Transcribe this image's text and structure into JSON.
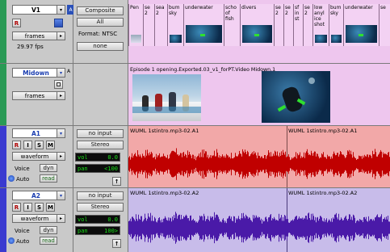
{
  "tracks": {
    "v1": {
      "name": "V1",
      "rec_btn": "R",
      "view": "frames",
      "fps": "29.97 fps",
      "composite": "Composite",
      "all": "All",
      "format": "Format: NTSC",
      "none": "none",
      "clip_labels": [
        "Pen",
        "se 2",
        "sea 2",
        "bum sky",
        "underwater",
        "scho of fish",
        "divers",
        "se 2",
        "se 2",
        "sf in st",
        "se 2",
        "low anyl ice shot",
        "bum sky",
        "underwater",
        "se"
      ]
    },
    "midown": {
      "name": "Midown",
      "view": "frames",
      "clip_title": "Episode 1 opening.Exported.03_v1_forPT.Video Midown.1"
    },
    "a1": {
      "name": "A1",
      "buttons": [
        "R",
        "I",
        "S",
        "M"
      ],
      "view": "waveform",
      "voice_label": "Voice",
      "voice_value": "dyn",
      "auto_label": "Auto",
      "auto_value": "read",
      "input": "no input",
      "output": "Stereo",
      "vol_label": "vol",
      "vol_value": "0.0",
      "pan_label": "pan",
      "pan_value": "<100",
      "clip_a": "WUML 1stintro.mp3-02.A1",
      "clip_b": "WUML 1stintro.mp3-02.A1",
      "wave_color": "#c00000",
      "bg_color": "#f2a8a8"
    },
    "a2": {
      "name": "A2",
      "buttons": [
        "R",
        "I",
        "S",
        "M"
      ],
      "view": "waveform",
      "voice_label": "Voice",
      "voice_value": "dyn",
      "auto_label": "Auto",
      "auto_value": "read",
      "input": "no input",
      "output": "Stereo",
      "vol_label": "vol",
      "vol_value": "0.0",
      "pan_label": "pan",
      "pan_value": "100>",
      "clip_a": "WUML 1stintro.mp3-02.A2",
      "clip_b": "WUML 1stintro.mp3-02.A2",
      "wave_color": "#4a1aa8",
      "bg_color": "#c8bcea"
    }
  },
  "colors": {
    "video_bg": "#eec6ee",
    "video_strip": "#d9a3d9",
    "accent_blue": "#2a50b8",
    "track_color_a": "#3a3ad0",
    "track_color_v": "#2a9a55"
  }
}
